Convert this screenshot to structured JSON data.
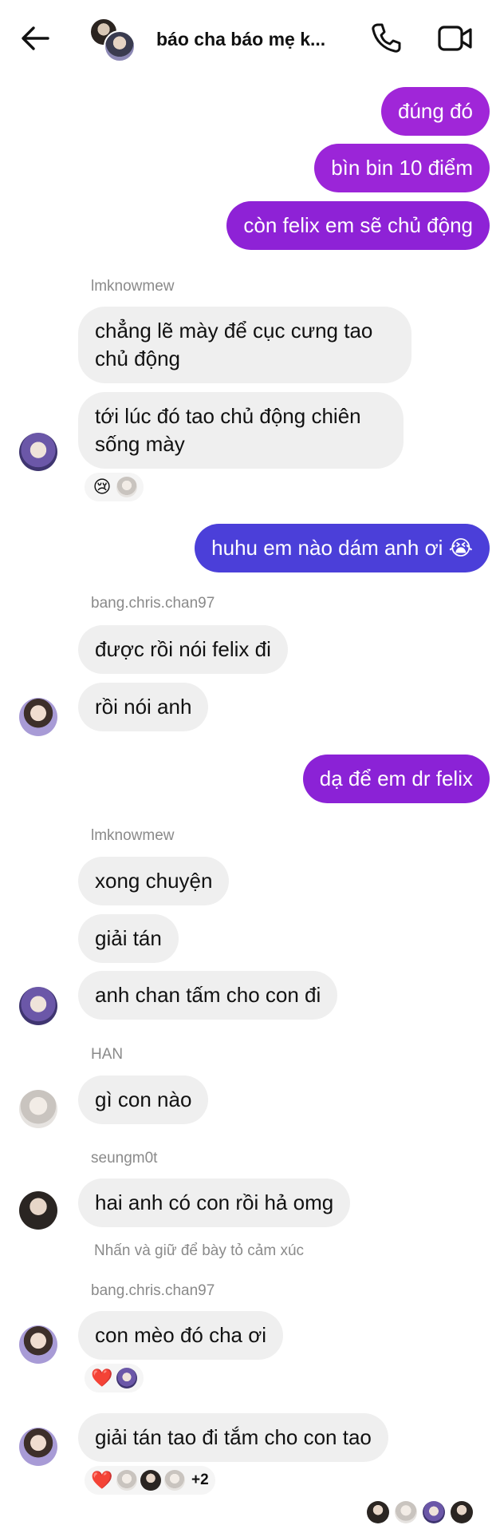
{
  "header": {
    "back_icon": "back-arrow-icon",
    "title": "báo cha báo mẹ k...",
    "call_icon": "phone-icon",
    "video_icon": "video-camera-icon"
  },
  "colors": {
    "outgoing_top": "#a026d8",
    "outgoing_mid": "#8b22d6",
    "outgoing_blue": "#4b3fd9",
    "incoming": "#efefef",
    "meta_text": "#8a8a8a"
  },
  "messages": [
    {
      "side": "out",
      "text": "đúng đó"
    },
    {
      "side": "out",
      "text": "bìn bin 10 điểm"
    },
    {
      "side": "out",
      "text": "còn felix em sẽ chủ động"
    },
    {
      "side": "sender",
      "text": "lmknowmew"
    },
    {
      "side": "in",
      "text": "chẳng lẽ mày để cục cưng tao chủ động"
    },
    {
      "side": "in",
      "text": "tới lúc đó tao chủ động chiên sống mày"
    },
    {
      "side": "out",
      "text": "huhu em nào dám anh ơi 😭"
    },
    {
      "side": "sender",
      "text": "bang.chris.chan97"
    },
    {
      "side": "in",
      "text": "được rồi nói felix đi"
    },
    {
      "side": "in",
      "text": "rồi nói anh"
    },
    {
      "side": "out",
      "text": "dạ để em dr felix"
    },
    {
      "side": "sender",
      "text": "lmknowmew"
    },
    {
      "side": "in",
      "text": "xong chuyện"
    },
    {
      "side": "in",
      "text": "giải tán"
    },
    {
      "side": "in",
      "text": "anh chan tấm cho con đi"
    },
    {
      "side": "sender",
      "text": "HAN"
    },
    {
      "side": "in",
      "text": "gì con nào"
    },
    {
      "side": "sender",
      "text": "seungm0t"
    },
    {
      "side": "in",
      "text": "hai anh có con rồi hả omg"
    },
    {
      "side": "hint",
      "text": "Nhấn và giữ để bày tỏ cảm xúc"
    },
    {
      "side": "sender",
      "text": "bang.chris.chan97"
    },
    {
      "side": "in",
      "text": "con mèo đó cha ơi"
    },
    {
      "side": "in",
      "text": "giải tán tao đi tắm cho con tao"
    }
  ],
  "reactions": [
    {
      "emoji": "😢",
      "avatars": 1
    },
    {
      "emoji": "❤️",
      "avatars": 1
    },
    {
      "emoji": "❤️",
      "avatars": 3,
      "more": "+2"
    }
  ],
  "seen_by_count": 4
}
